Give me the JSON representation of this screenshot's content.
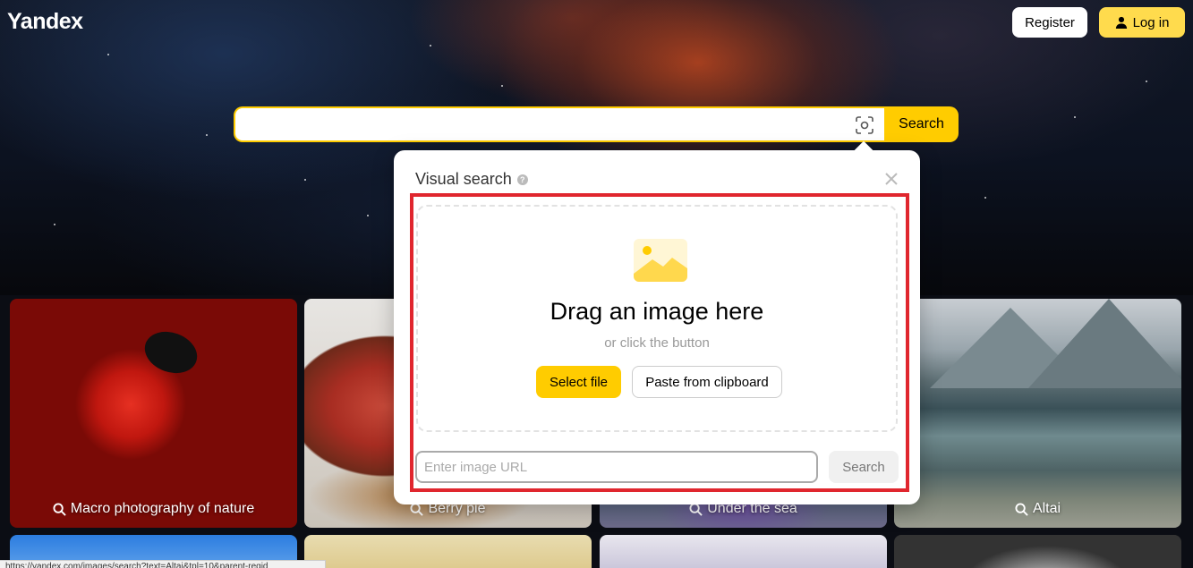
{
  "header": {
    "logo": "Yandex",
    "register_label": "Register",
    "login_label": "Log in"
  },
  "search": {
    "value": "",
    "button_label": "Search"
  },
  "visual_search": {
    "title": "Visual search",
    "drag_title": "Drag an image here",
    "drag_subtitle": "or click the button",
    "select_file_label": "Select file",
    "paste_label": "Paste from clipboard",
    "url_placeholder": "Enter image URL",
    "url_search_label": "Search"
  },
  "tiles": [
    {
      "caption": "Macro photography of nature"
    },
    {
      "caption": "Berry pie"
    },
    {
      "caption": "Under the sea"
    },
    {
      "caption": "Altai"
    }
  ],
  "status_bar": {
    "url": "https://yandex.com/images/search?text=Altai&tpl=10&parent-reqid"
  },
  "colors": {
    "accent": "#ffcc00",
    "highlight": "#e0262e"
  },
  "icons": {
    "login": "user-icon",
    "camera": "camera-scan-icon",
    "close": "close-icon",
    "help": "question-icon",
    "tile": "search-icon"
  }
}
